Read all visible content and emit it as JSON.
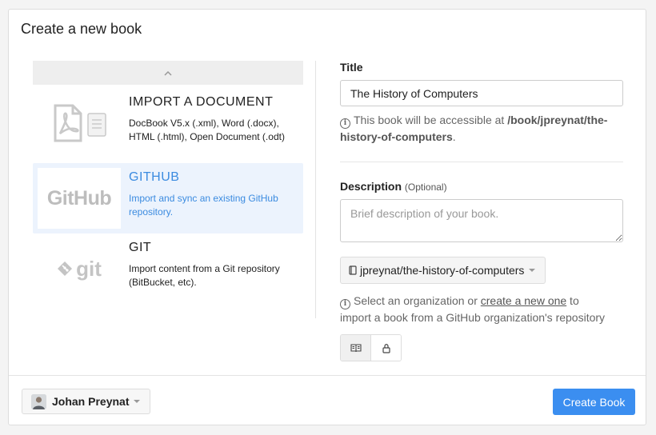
{
  "dialog": {
    "title": "Create a new book"
  },
  "sources": [
    {
      "name": "IMPORT A DOCUMENT",
      "desc_line1": "DocBook V5.x (.xml), Word (.docx),",
      "desc_line2": "HTML (.html), Open Document (.odt)",
      "icon": "pdf-document-icon"
    },
    {
      "name": "GITHUB",
      "desc_line1": "Import and sync an existing GitHub",
      "desc_line2": "repository.",
      "icon": "github-logo",
      "logo_text": "GitHub"
    },
    {
      "name": "GIT",
      "desc_line1": "Import content from a Git repository",
      "desc_line2": "(BitBucket, etc).",
      "icon": "git-logo",
      "logo_text": "git"
    }
  ],
  "form": {
    "title_label": "Title",
    "title_value": "The History of Computers",
    "url_help_prefix": "This book will be accessible at ",
    "url_path_line1": "/book/jpreynat/the-",
    "url_path_line2": "history-of-computers",
    "url_help_suffix": ".",
    "description_label": "Description",
    "description_optional": "(Optional)",
    "description_placeholder": "Brief description of your book.",
    "repo_selected": "jpreynat/the-history-of-computers",
    "org_help_prefix": "Select an organization or ",
    "org_help_link": "create a new one",
    "org_help_suffix_line1": " to",
    "org_help_line2": "import a book from a GitHub organization's repository"
  },
  "footer": {
    "owner_name": "Johan Preynat",
    "create_label": "Create Book"
  },
  "colors": {
    "accent": "#3b8ef0",
    "active_bg": "#ecf3fd"
  }
}
